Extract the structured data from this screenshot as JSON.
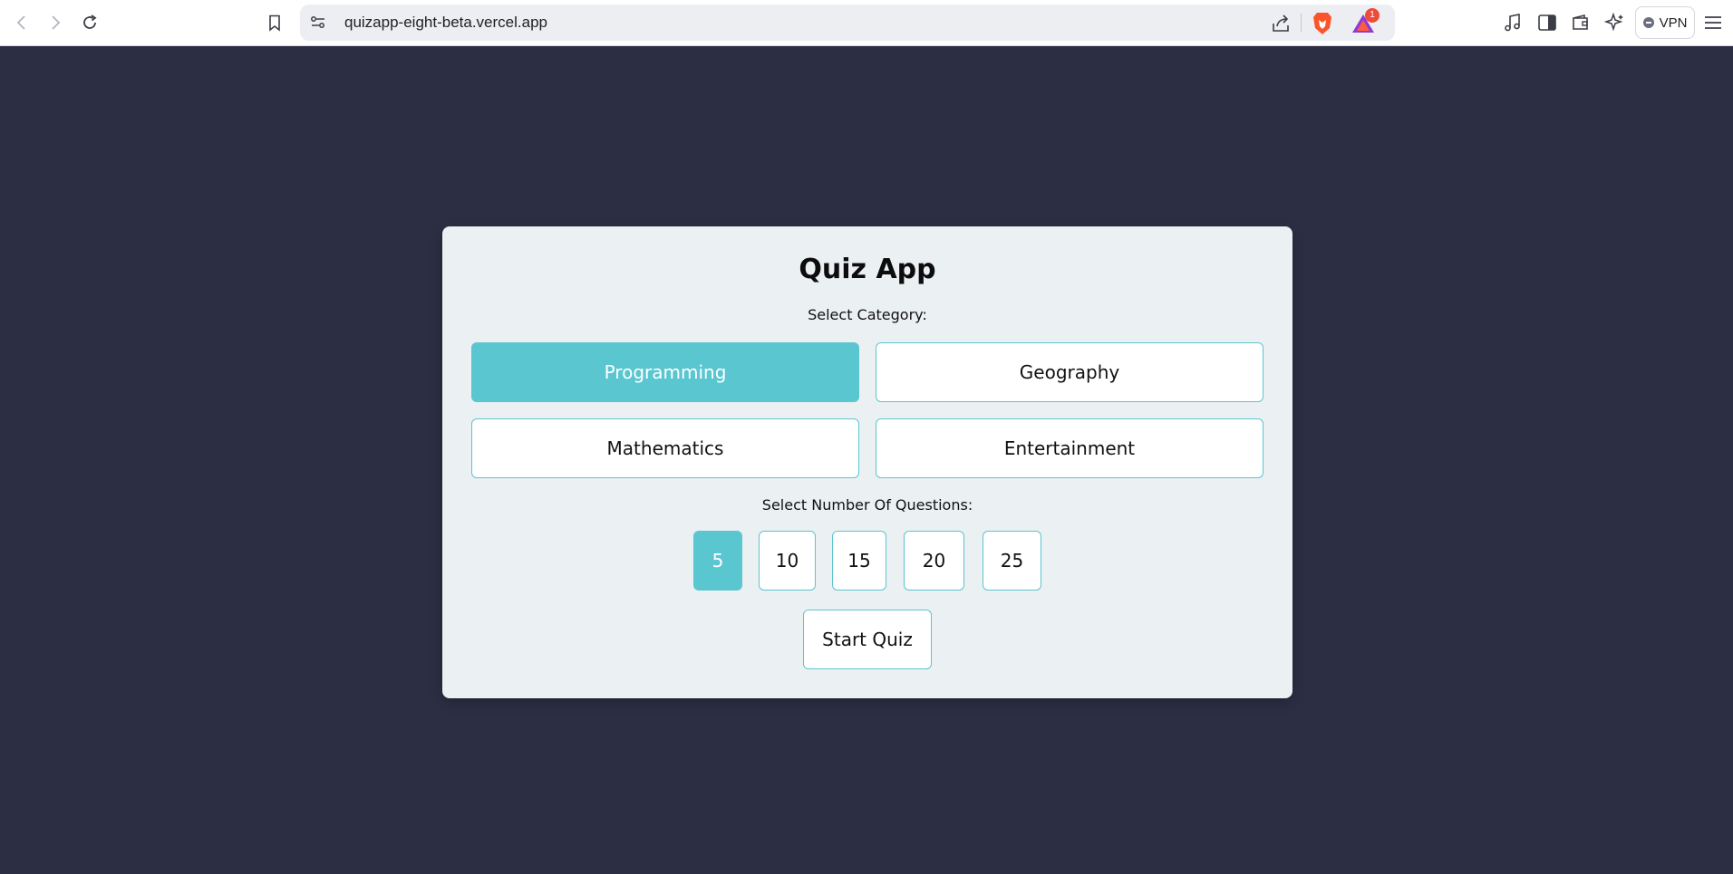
{
  "browser": {
    "url": "quizapp-eight-beta.vercel.app",
    "rewards_badge": "1",
    "vpn_label": "VPN",
    "icons": {
      "back": "back-arrow-icon",
      "forward": "forward-arrow-icon",
      "reload": "reload-icon",
      "bookmark": "bookmark-icon",
      "site_settings": "site-settings-icon",
      "share": "share-icon",
      "shields": "brave-shields-icon",
      "rewards": "brave-rewards-icon",
      "media": "music-note-icon",
      "sidebar": "sidebar-icon",
      "wallet": "wallet-icon",
      "leo": "leo-ai-icon",
      "menu": "hamburger-menu-icon"
    }
  },
  "quiz": {
    "title": "Quiz App",
    "category_label": "Select Category:",
    "categories": [
      {
        "label": "Programming",
        "selected": true
      },
      {
        "label": "Geography",
        "selected": false
      },
      {
        "label": "Mathematics",
        "selected": false
      },
      {
        "label": "Entertainment",
        "selected": false
      }
    ],
    "count_label": "Select Number Of Questions:",
    "counts": [
      {
        "label": "5",
        "selected": true
      },
      {
        "label": "10",
        "selected": false
      },
      {
        "label": "15",
        "selected": false
      },
      {
        "label": "20",
        "selected": false
      },
      {
        "label": "25",
        "selected": false
      }
    ],
    "start_label": "Start Quiz"
  },
  "colors": {
    "page_background": "#2c2e43",
    "card_background": "#ebf0f2",
    "accent": "#5ac6d0",
    "badge": "#ef4b3b"
  }
}
